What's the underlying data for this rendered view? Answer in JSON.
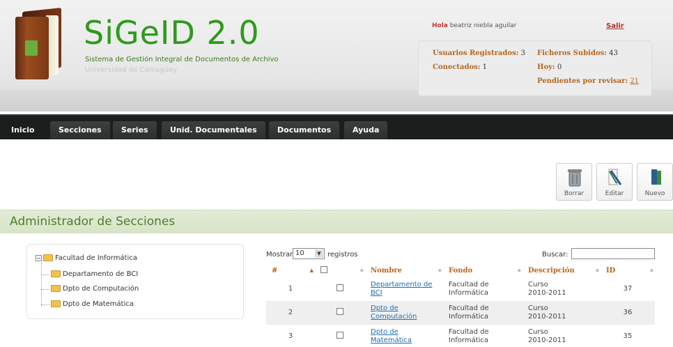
{
  "app": {
    "title": "SiGeID 2.0",
    "subtitle": "Sistema de Gestión Integral de Documentos de Archivo",
    "institution": "Universidad de Camagüey"
  },
  "user": {
    "greeting": "Hola",
    "name": "beatriz niebla aguilar",
    "logout_label": "Salir"
  },
  "stats": {
    "registered_label": "Usuarios Registrados:",
    "registered_value": "3",
    "connected_label": "Conectados:",
    "connected_value": "1",
    "uploaded_label": "Ficheros Subidos:",
    "uploaded_value": "43",
    "today_label": "Hoy:",
    "today_value": "0",
    "pending_label": "Pendientes por revisar:",
    "pending_value": "21"
  },
  "nav": {
    "items": [
      "Inicio",
      "Secciones",
      "Series",
      "Unid. Documentales",
      "Documentos",
      "Ayuda"
    ]
  },
  "toolbar": {
    "delete_label": "Borrar",
    "edit_label": "Editar",
    "new_label": "Nuevo"
  },
  "section": {
    "title": "Administrador de Secciones"
  },
  "tree": {
    "root": "Facultad de Informática",
    "children": [
      "Departamento de BCI",
      "Dpto de Computación",
      "Dpto de Matemática"
    ]
  },
  "table": {
    "show_label": "Mostrar",
    "page_size": "10",
    "records_label": "registros",
    "search_label": "Buscar:",
    "search_value": "",
    "columns": [
      "#",
      "",
      "Nombre",
      "Fondo",
      "Descripción",
      "ID"
    ],
    "rows": [
      {
        "num": "1",
        "name_l1": "Departamento de",
        "name_l2": "BCI",
        "fondo_l1": "Facultad de",
        "fondo_l2": "Informática",
        "desc_l1": "Curso",
        "desc_l2": "2010-2011",
        "id": "37"
      },
      {
        "num": "2",
        "name_l1": "Dpto de",
        "name_l2": "Computación",
        "fondo_l1": "Facultad de",
        "fondo_l2": "Informática",
        "desc_l1": "Curso",
        "desc_l2": "2010-2011",
        "id": "36"
      },
      {
        "num": "3",
        "name_l1": "Dpto de",
        "name_l2": "Matemática",
        "fondo_l1": "Facultad de",
        "fondo_l2": "Informática",
        "desc_l1": "Curso",
        "desc_l2": "2010-2011",
        "id": "35"
      }
    ]
  },
  "colors": {
    "brand_green": "#2e9a1b",
    "accent_orange": "#b5651d",
    "nav_dark": "#1a1f1e",
    "section_bg": "#dfe9d1",
    "link_blue": "#1f6fae"
  },
  "icons": {
    "logo": "book-icon",
    "delete": "trash-icon",
    "edit": "pencil-icon",
    "new": "new-document-icon",
    "folder": "folder-icon",
    "tree_toggle": "minus-toggle-icon"
  }
}
